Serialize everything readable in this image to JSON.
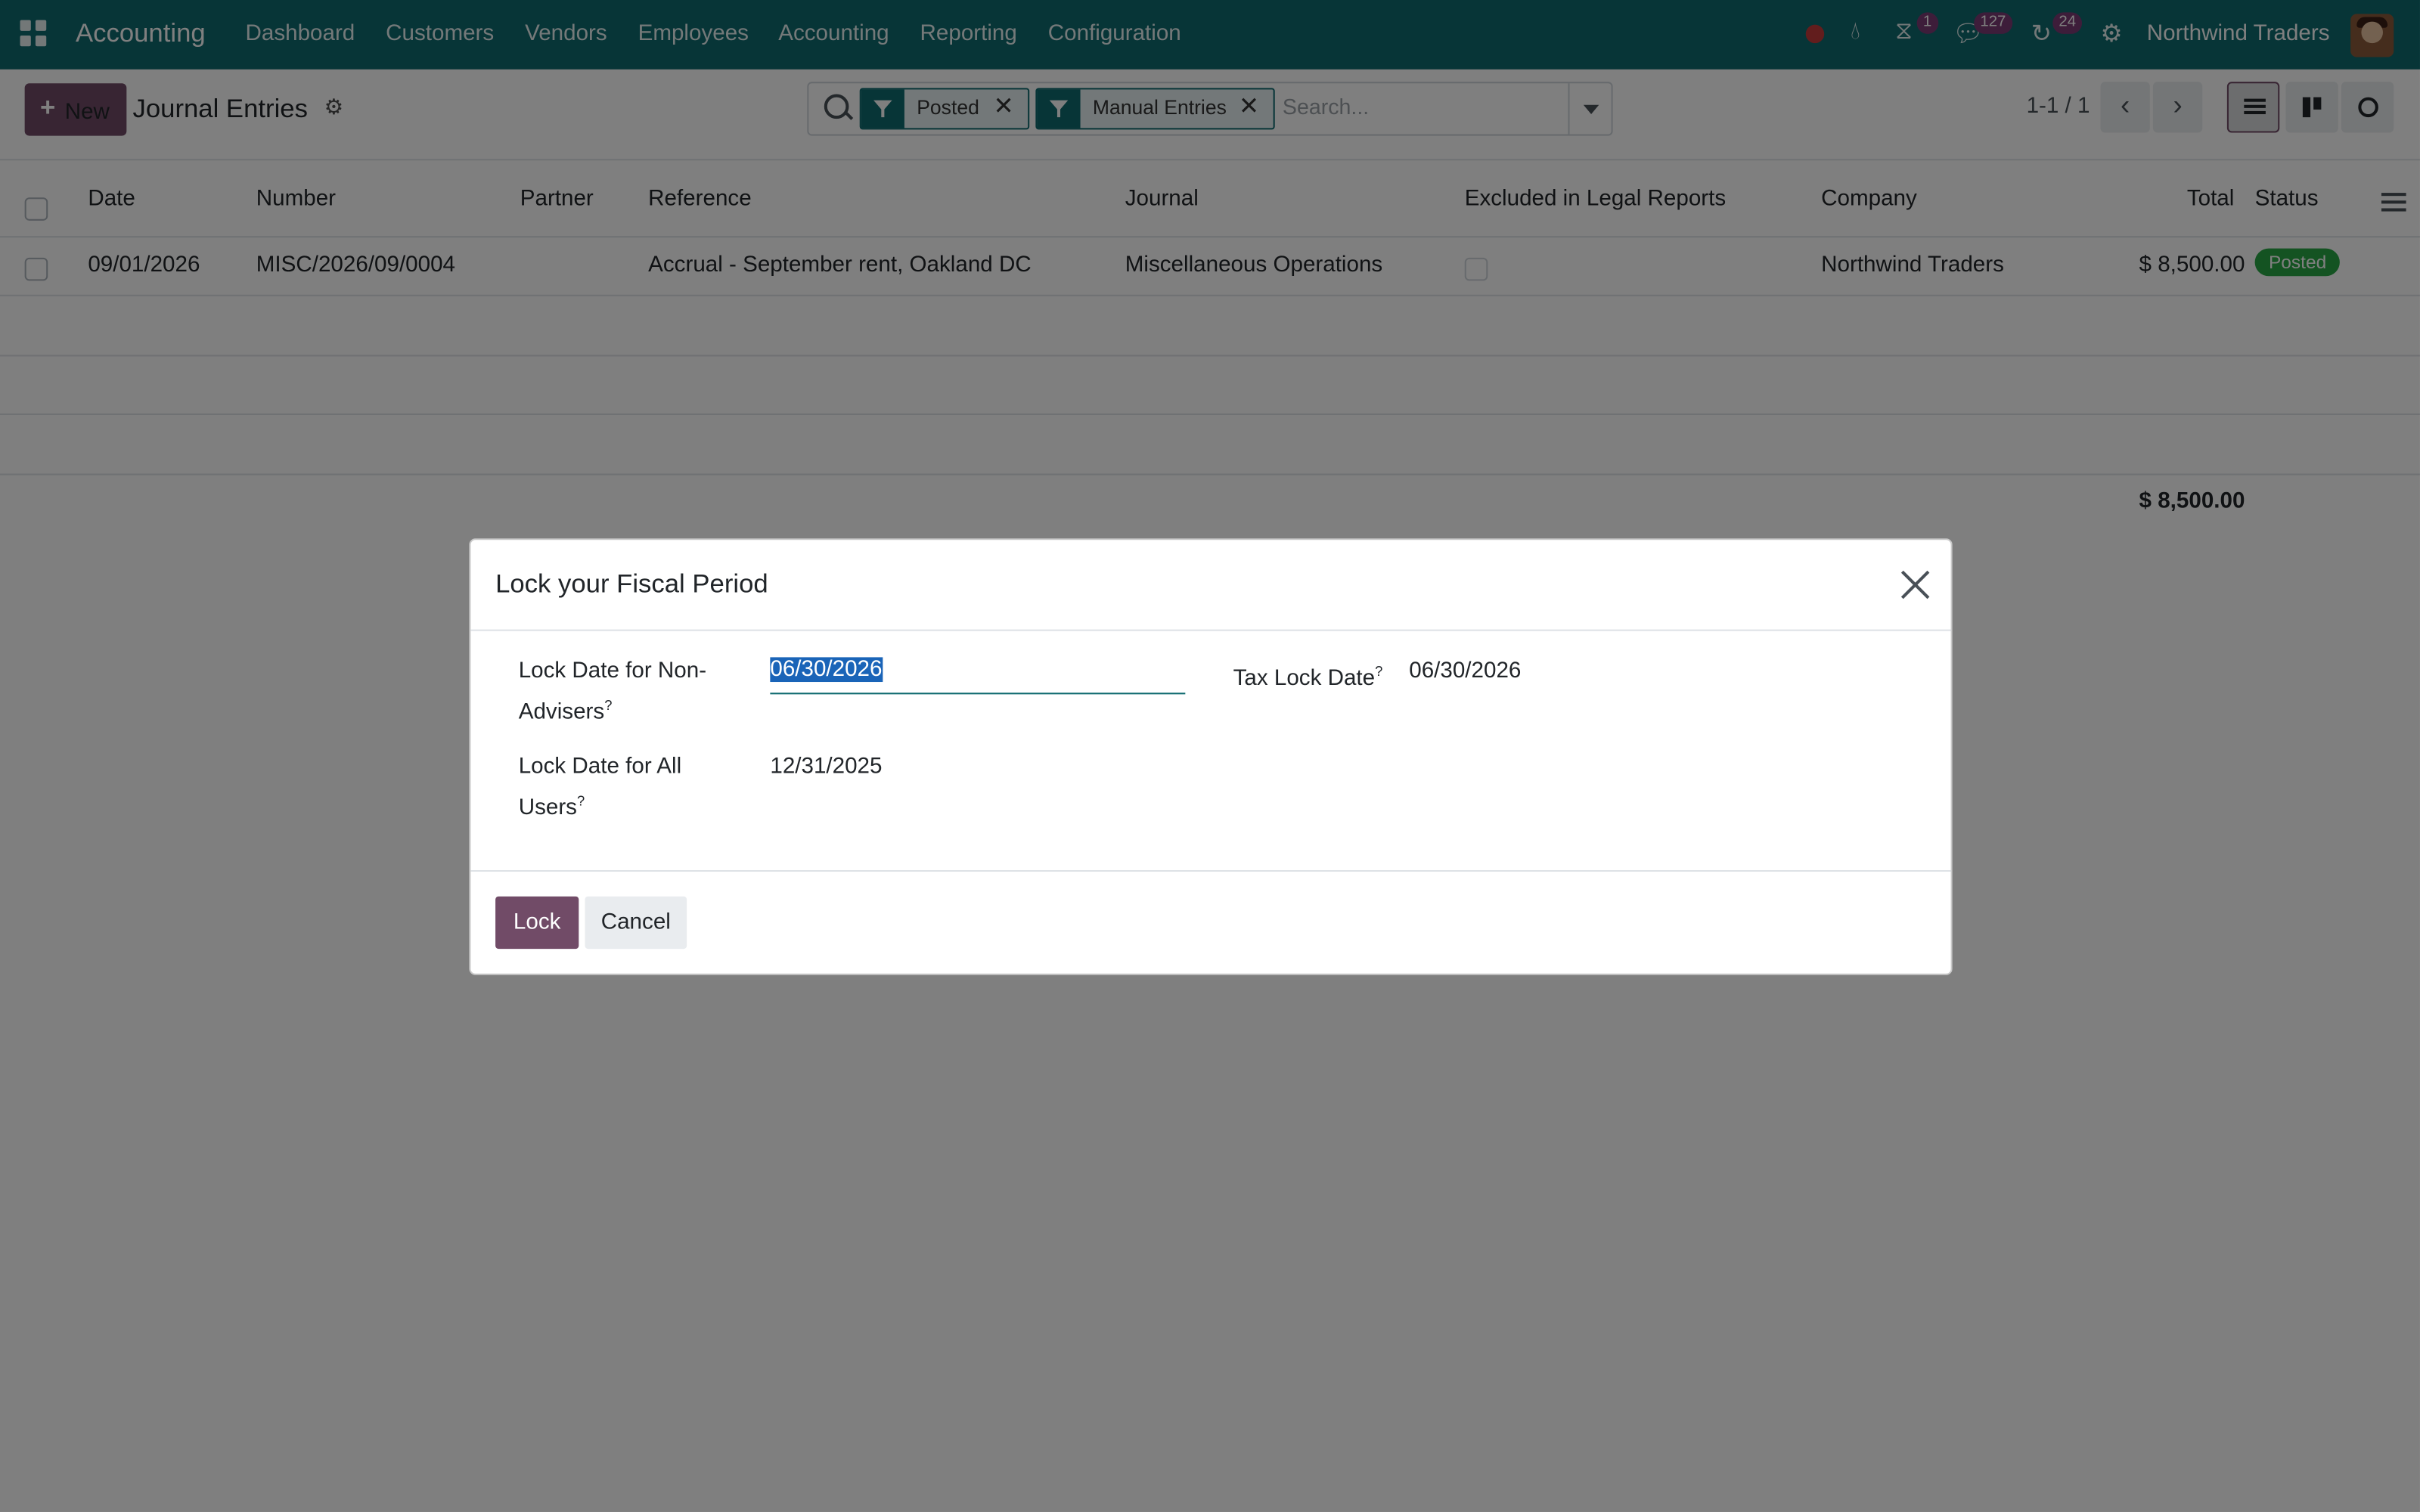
{
  "navbar": {
    "brand": "Accounting",
    "menu": [
      "Dashboard",
      "Customers",
      "Vendors",
      "Employees",
      "Accounting",
      "Reporting",
      "Configuration"
    ],
    "badges": {
      "activities": "1",
      "messages": "127",
      "timer": "24"
    },
    "company": "Northwind Traders"
  },
  "control": {
    "new_label": "New",
    "breadcrumb": "Journal Entries",
    "facets": [
      "Posted",
      "Manual Entries"
    ],
    "search_placeholder": "Search...",
    "pager": "1-1 / 1"
  },
  "list": {
    "columns": [
      "Date",
      "Number",
      "Partner",
      "Reference",
      "Journal",
      "Excluded in Legal Reports",
      "Company",
      "Total",
      "Status"
    ],
    "rows": [
      {
        "date": "09/01/2026",
        "number": "MISC/2026/09/0004",
        "partner": "",
        "reference": "Accrual - September rent, Oakland DC",
        "journal": "Miscellaneous Operations",
        "company": "Northwind Traders",
        "total": "$ 8,500.00",
        "status": "Posted"
      }
    ],
    "footer_total": "$ 8,500.00"
  },
  "modal": {
    "title": "Lock your Fiscal Period",
    "non_advisers_label": "Lock Date for Non-Advisers",
    "non_advisers_value": "06/30/2026",
    "all_users_label": "Lock Date for All Users",
    "all_users_value": "12/31/2025",
    "tax_label": "Tax Lock Date",
    "tax_value": "06/30/2026",
    "help_mark": "?",
    "lock_label": "Lock",
    "cancel_label": "Cancel"
  }
}
